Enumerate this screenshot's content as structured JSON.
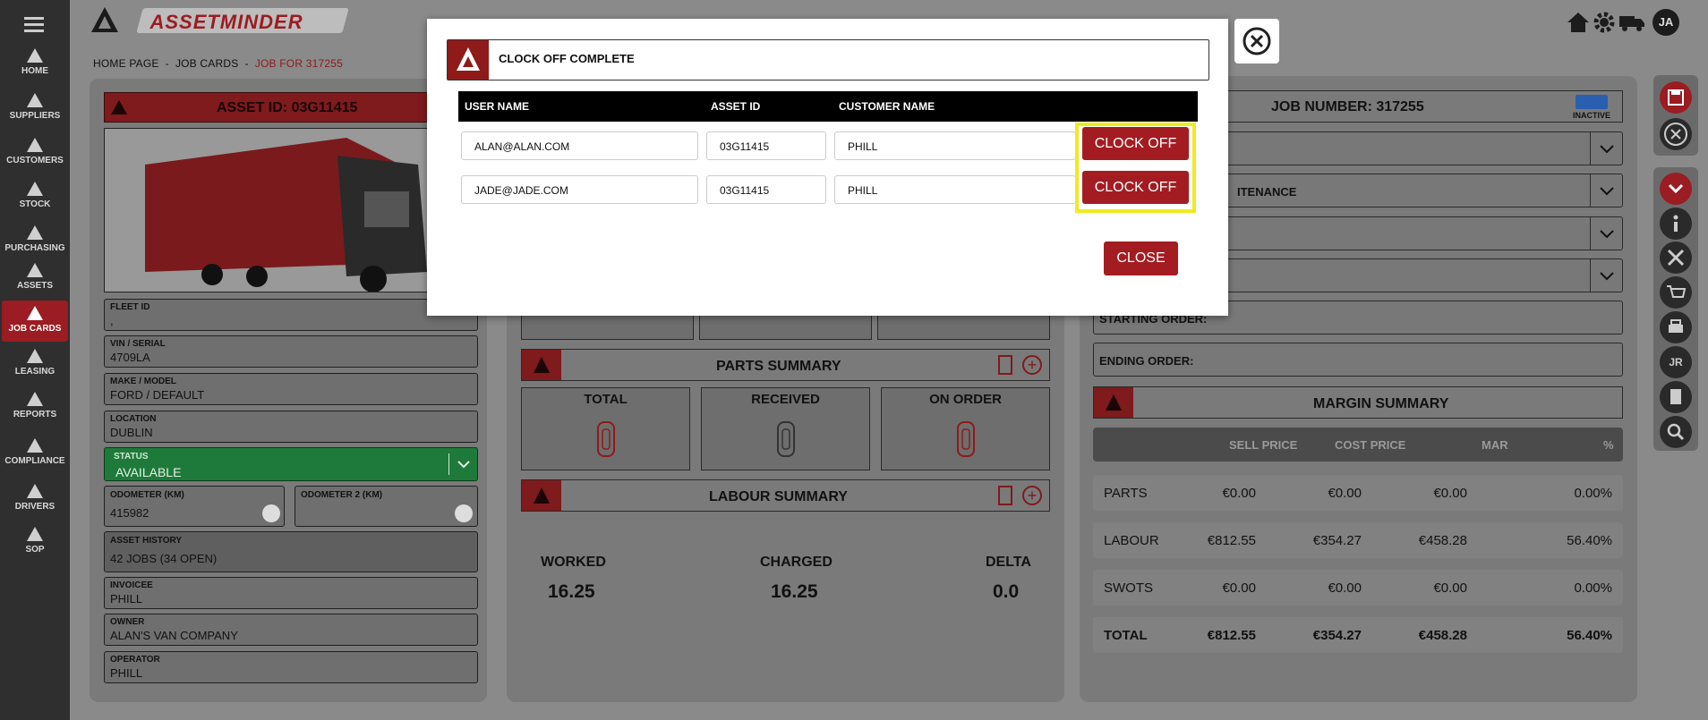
{
  "app": {
    "logo_text": "ASSETMINDER",
    "user_initials": "JA"
  },
  "sidebar": {
    "items": [
      {
        "label": "HOME",
        "icon": "home-logo-icon"
      },
      {
        "label": "SUPPLIERS",
        "icon": "suppliers-icon"
      },
      {
        "label": "CUSTOMERS",
        "icon": "customers-icon"
      },
      {
        "label": "STOCK",
        "icon": "stock-icon"
      },
      {
        "label": "PURCHASING",
        "icon": "purchasing-icon"
      },
      {
        "label": "ASSETS",
        "icon": "truck-icon"
      },
      {
        "label": "JOB CARDS",
        "icon": "tools-icon"
      },
      {
        "label": "LEASING",
        "icon": "leasing-icon"
      },
      {
        "label": "REPORTS",
        "icon": "reports-icon"
      },
      {
        "label": "COMPLIANCE",
        "icon": "compliance-icon"
      },
      {
        "label": "DRIVERS",
        "icon": "drivers-icon"
      },
      {
        "label": "SOP",
        "icon": "sop-icon"
      }
    ]
  },
  "breadcrumb": {
    "home": "HOME PAGE",
    "sep": "-",
    "jobcards": "JOB CARDS",
    "current": "JOB FOR 317255"
  },
  "asset": {
    "header": "ASSET ID: 03G11415",
    "fields": [
      {
        "label": "FLEET ID",
        "value": ","
      },
      {
        "label": "VIN / SERIAL",
        "value": "4709LA"
      },
      {
        "label": "MAKE / MODEL",
        "value": "FORD / DEFAULT"
      },
      {
        "label": "LOCATION",
        "value": "DUBLIN"
      }
    ],
    "status_label": "STATUS",
    "status_value": "AVAILABLE",
    "odometer_label": "ODOMETER (KM)",
    "odometer_value": "415982",
    "odometer2_label": "ODOMETER 2 (KM)",
    "history_label": "ASSET HISTORY",
    "history_value": "42 JOBS (34 OPEN)",
    "invoicee_label": "INVOICEE",
    "invoicee_value": "PHILL",
    "owner_label": "OWNER",
    "owner_value": "ALAN'S VAN COMPANY",
    "operator_label": "OPERATOR",
    "operator_value": "PHILL"
  },
  "middle": {
    "parts_title": "PARTS SUMMARY",
    "parts_boxes": [
      "TOTAL",
      "RECEIVED",
      "ON ORDER"
    ],
    "labour_title": "LABOUR SUMMARY",
    "worked_label": "WORKED",
    "worked_value": "16.25",
    "charged_label": "CHARGED",
    "charged_value": "16.25",
    "delta_label": "DELTA",
    "delta_value": "0.0"
  },
  "right": {
    "job_number": "JOB NUMBER: 317255",
    "inactive_label": "INACTIVE",
    "maintenance_partial": "ITENANCE",
    "starting_order": "STARTING ORDER:",
    "ending_order": "ENDING ORDER:",
    "margin_title": "MARGIN SUMMARY",
    "margin_headers": [
      "SELL PRICE",
      "COST PRICE",
      "MAR",
      "%"
    ],
    "margin_rows": [
      {
        "label": "PARTS",
        "sell": "€0.00",
        "cost": "€0.00",
        "mar": "€0.00",
        "pct": "0.00%"
      },
      {
        "label": "LABOUR",
        "sell": "€812.55",
        "cost": "€354.27",
        "mar": "€458.28",
        "pct": "56.40%"
      },
      {
        "label": "SWOTS",
        "sell": "€0.00",
        "cost": "€0.00",
        "mar": "€0.00",
        "pct": "0.00%"
      },
      {
        "label": "TOTAL",
        "sell": "€812.55",
        "cost": "€354.27",
        "mar": "€458.28",
        "pct": "56.40%"
      }
    ],
    "tool_badge": "JR"
  },
  "modal": {
    "title": "CLOCK OFF COMPLETE",
    "columns": [
      "USER NAME",
      "ASSET ID",
      "CUSTOMER NAME"
    ],
    "rows": [
      {
        "user": "ALAN@ALAN.COM",
        "asset": "03G11415",
        "customer": "PHILL",
        "action": "CLOCK OFF"
      },
      {
        "user": "JADE@JADE.COM",
        "asset": "03G11415",
        "customer": "PHILL",
        "action": "CLOCK OFF"
      }
    ],
    "close_label": "CLOSE"
  }
}
